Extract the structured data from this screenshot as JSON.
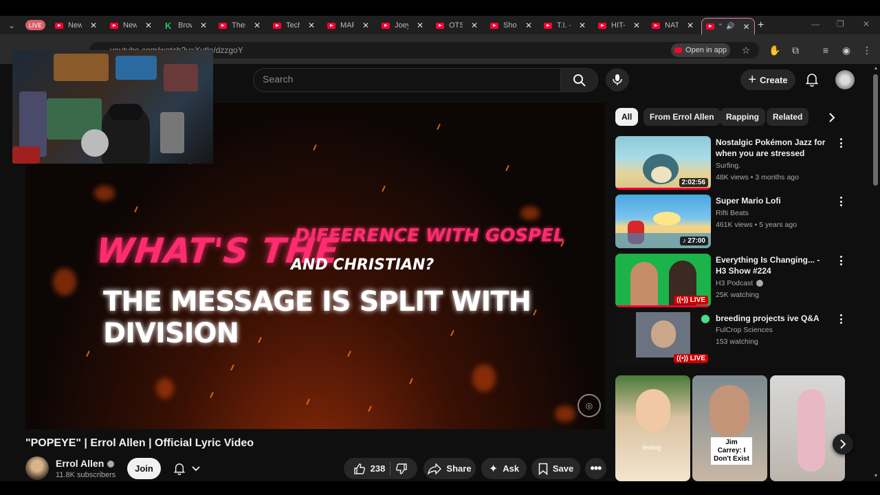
{
  "browser": {
    "live_label": "LIVE",
    "tabs": [
      {
        "label": "New",
        "icon": "youtube-icon"
      },
      {
        "label": "New",
        "icon": "youtube-icon"
      },
      {
        "label": "Brow",
        "icon": "k-icon"
      },
      {
        "label": "Ther",
        "icon": "youtube-icon"
      },
      {
        "label": "Tech",
        "icon": "youtube-icon"
      },
      {
        "label": "MAF",
        "icon": "youtube-icon"
      },
      {
        "label": "Joey",
        "icon": "youtube-icon"
      },
      {
        "label": "OTS",
        "icon": "youtube-icon"
      },
      {
        "label": "Shor",
        "icon": "youtube-icon"
      },
      {
        "label": "T.I. -",
        "icon": "youtube-icon"
      },
      {
        "label": "HIT-",
        "icon": "youtube-icon"
      },
      {
        "label": "NAT",
        "icon": "youtube-icon"
      },
      {
        "label": "\"",
        "icon": "youtube-icon"
      }
    ],
    "url": "youtube.com/watch?v=Xutlo/dzzgoY",
    "open_in_app": "Open in app"
  },
  "youtube": {
    "search_placeholder": "Search",
    "create_label": "Create"
  },
  "video": {
    "lyrics": {
      "line_pink_big": "WHAT'S THE",
      "line_pink_small": "DIFFERENCE WITH GOSPEL",
      "line_white_small": "AND CHRISTIAN?",
      "line_white_big": "THE MESSAGE IS SPLIT WITH DIVISION"
    },
    "title": "\"POPEYE\" | Errol Allen | Official Lyric Video",
    "channel": "Errol Allen",
    "subscribers": "11.8K subscribers",
    "join_label": "Join",
    "likes": "238",
    "share_label": "Share",
    "ask_label": "Ask",
    "save_label": "Save"
  },
  "chips": [
    "All",
    "From Errol Allen",
    "Rapping",
    "Related"
  ],
  "recommendations": [
    {
      "title": "Nostalgic Pokémon Jazz for when you are stressed",
      "channel": "Surfing.",
      "meta": "48K views • 3 months ago",
      "duration": "2:02:56"
    },
    {
      "title": "Super Mario Lofi",
      "channel": "Rifti Beats",
      "meta": "461K views • 5 years ago",
      "duration": "♪ 27:00"
    },
    {
      "title": "Everything Is Changing... - H3 Show #224",
      "channel": "H3 Podcast",
      "meta": "25K watching",
      "duration": "((•)) LIVE"
    },
    {
      "title": "breeding projects ive Q&A",
      "channel": "FulCrop Sciences",
      "meta": "153 watching",
      "duration": "((•)) LIVE"
    }
  ],
  "shorts": [
    {
      "caption": "feeling"
    },
    {
      "caption": "Jim Carrey: I Don't Exist"
    },
    {
      "caption": ""
    }
  ]
}
